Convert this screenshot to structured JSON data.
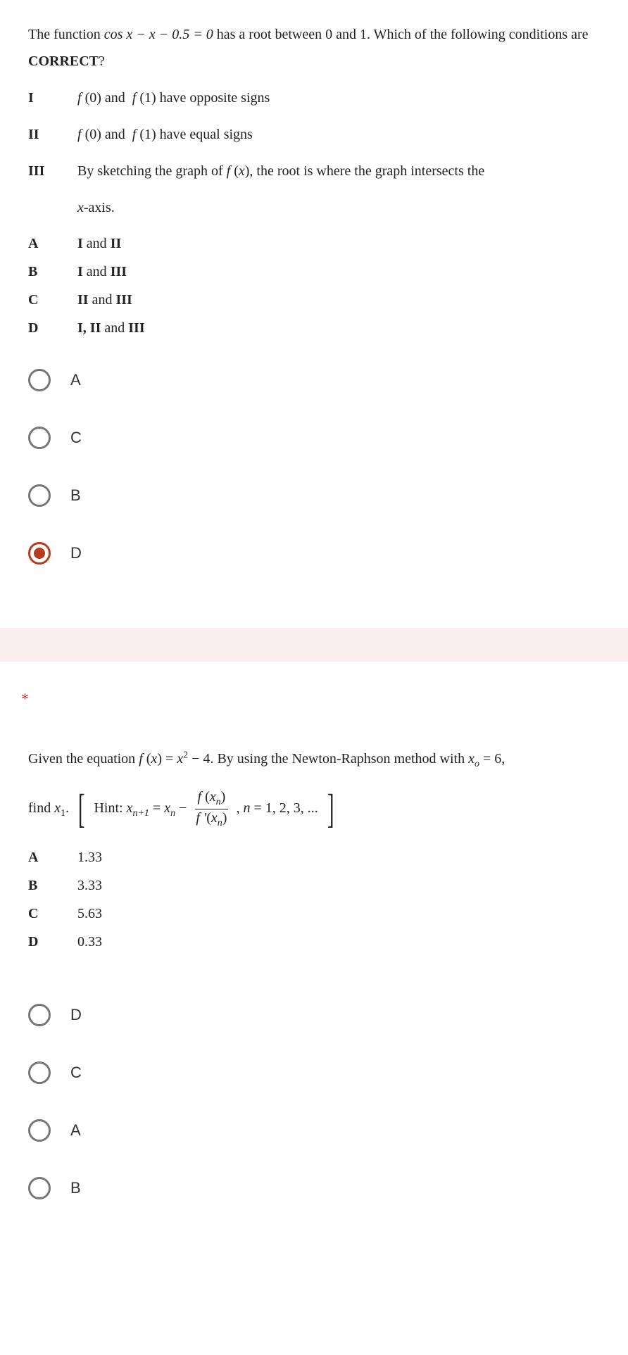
{
  "q1": {
    "intro_part1": "The function ",
    "intro_eq": "cos x − x − 0.5 = 0",
    "intro_part2": " has a root between 0 and 1. Which of the following conditions are ",
    "intro_bold": "CORRECT",
    "intro_q": "?",
    "conditions": [
      {
        "label": "I",
        "html": "f(0) and f(1) have opposite signs"
      },
      {
        "label": "II",
        "html": "f(0) and f(1) have equal signs"
      },
      {
        "label": "III",
        "html_a": "By sketching the graph of ",
        "html_b": "f(x)",
        "html_c": ", the root is where the graph intersects the",
        "html_d": "x-axis."
      }
    ],
    "options": [
      {
        "label": "A",
        "text": "I and II"
      },
      {
        "label": "B",
        "text": "I and III"
      },
      {
        "label": "C",
        "text": "II and III"
      },
      {
        "label": "D",
        "text": "I, II and III"
      }
    ],
    "radios": [
      {
        "label": "A",
        "selected": false
      },
      {
        "label": "C",
        "selected": false
      },
      {
        "label": "B",
        "selected": false
      },
      {
        "label": "D",
        "selected": true
      }
    ]
  },
  "q2": {
    "required": "*",
    "intro_a": "Given the equation ",
    "intro_eq": "f (x) = x² − 4",
    "intro_b": ". By using the Newton-Raphson method with ",
    "intro_x0": "xₒ = 6,",
    "find": "find ",
    "find_x1": "x₁.",
    "hint_label": "Hint: ",
    "hint_lhs": "xₙ₊₁ = xₙ −",
    "hint_num": "f (xₙ)",
    "hint_den": "f '(xₙ)",
    "hint_n": ", n = 1, 2, 3, ...",
    "options": [
      {
        "label": "A",
        "text": "1.33"
      },
      {
        "label": "B",
        "text": "3.33"
      },
      {
        "label": "C",
        "text": "5.63"
      },
      {
        "label": "D",
        "text": "0.33"
      }
    ],
    "radios": [
      {
        "label": "D",
        "selected": false
      },
      {
        "label": "C",
        "selected": false
      },
      {
        "label": "A",
        "selected": false
      },
      {
        "label": "B",
        "selected": false
      }
    ]
  }
}
